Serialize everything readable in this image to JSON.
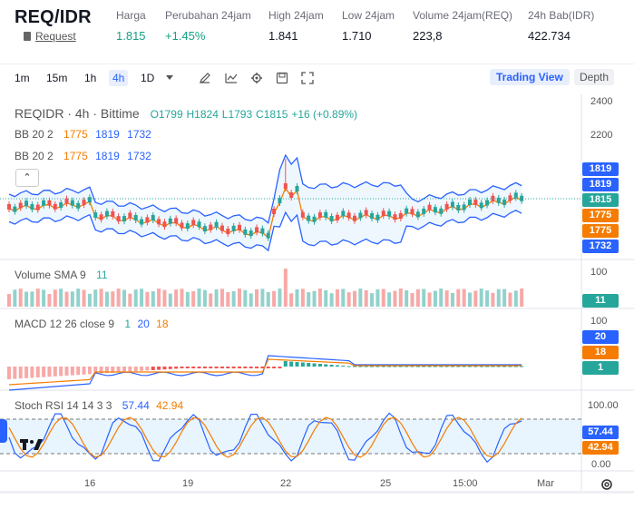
{
  "header": {
    "pair": "REQ/IDR",
    "request_label": "Request",
    "stats": [
      {
        "label": "Harga",
        "value": "1.815",
        "color": "green"
      },
      {
        "label": "Perubahan 24jam",
        "value": "+1.45%",
        "color": "green"
      },
      {
        "label": "High 24jam",
        "value": "1.841",
        "color": "dark"
      },
      {
        "label": "Low 24jam",
        "value": "1.710",
        "color": "dark"
      },
      {
        "label": "Volume 24jam(REQ)",
        "value": "223,8",
        "color": "dark"
      },
      {
        "label": "24h Bab(IDR)",
        "value": "422.734",
        "color": "dark"
      }
    ]
  },
  "toolbar": {
    "timeframes": [
      "1m",
      "15m",
      "1h",
      "4h",
      "1D"
    ],
    "active_timeframe": "4h",
    "trading_view_label": "Trading View",
    "depth_label": "Depth"
  },
  "legend": {
    "symbol": "REQIDR · 4h · Bittime",
    "o": "O1799",
    "h": "H1824",
    "l": "L1793",
    "c": "C1815",
    "change": "+16 (+0.89%)",
    "bb1": {
      "name": "BB 20 2",
      "v1": "1775",
      "v2": "1819",
      "v3": "1732"
    },
    "bb2": {
      "name": "BB 20 2",
      "v1": "1775",
      "v2": "1819",
      "v3": "1732"
    },
    "volume": {
      "name": "Volume SMA 9",
      "value": "11"
    },
    "macd": {
      "name": "MACD 12 26 close 9",
      "v1": "1",
      "v2": "20",
      "v3": "18"
    },
    "stoch": {
      "name": "Stoch RSI 14 14 3 3",
      "v1": "57.44",
      "v2": "42.94"
    }
  },
  "price_axis": {
    "labels": [
      "2400",
      "2200"
    ],
    "badges": [
      {
        "text": "1819",
        "color": "#2962ff"
      },
      {
        "text": "1819",
        "color": "#2962ff"
      },
      {
        "text": "1815",
        "color": "#26a69a"
      },
      {
        "text": "1775",
        "color": "#f57c00"
      },
      {
        "text": "1775",
        "color": "#f57c00"
      },
      {
        "text": "1732",
        "color": "#2962ff"
      }
    ]
  },
  "volume_axis": {
    "label": "100",
    "badge": "11"
  },
  "macd_axis": {
    "label": "100",
    "badges": [
      {
        "text": "20",
        "color": "#2962ff"
      },
      {
        "text": "18",
        "color": "#f57c00"
      },
      {
        "text": "1",
        "color": "#26a69a"
      }
    ]
  },
  "stoch_axis": {
    "top": "100.00",
    "bottom": "0.00",
    "badges": [
      {
        "text": "57.44",
        "color": "#2962ff"
      },
      {
        "text": "42.94",
        "color": "#f57c00"
      }
    ]
  },
  "time_axis": [
    "16",
    "19",
    "22",
    "25",
    "15:00",
    "Mar"
  ],
  "icons": [
    "pencil-icon",
    "indicator-icon",
    "gear-icon",
    "save-icon",
    "fullscreen-icon",
    "chevron-up-icon",
    "tradingview-logo-icon",
    "settings-gear-icon"
  ],
  "colors": {
    "up": "#26a69a",
    "down": "#ef5350",
    "bb": "#2962ff",
    "basis": "#f57c00"
  }
}
